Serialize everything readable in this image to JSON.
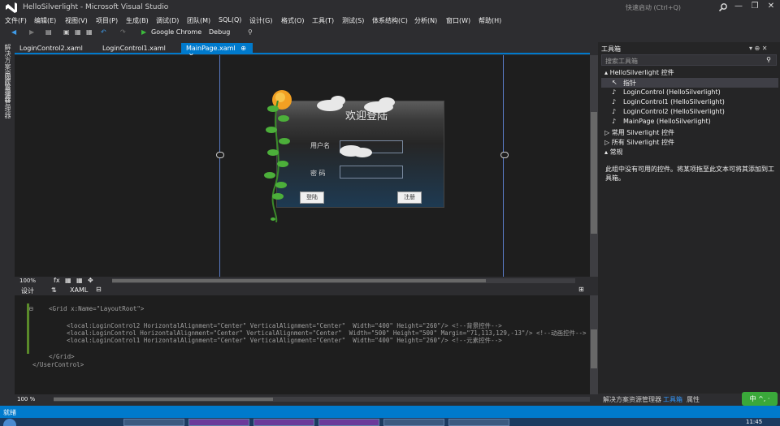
{
  "window": {
    "title": "HelloSilverlight - Microsoft Visual Studio",
    "quick_launch": "快速启动 (Ctrl+Q)",
    "controls": [
      "—",
      "❐",
      "✕"
    ]
  },
  "menu": [
    "文件(F)",
    "编辑(E)",
    "视图(V)",
    "项目(P)",
    "生成(B)",
    "调试(D)",
    "团队(M)",
    "SQL(Q)",
    "设计(G)",
    "格式(O)",
    "工具(T)",
    "测试(S)",
    "体系结构(C)",
    "分析(N)",
    "窗口(W)",
    "帮助(H)"
  ],
  "toolbar": {
    "browser": "Google Chrome",
    "config": "Debug"
  },
  "left_strip": [
    "解决方案资源管理器",
    "团队资源管理器"
  ],
  "doc_tabs": [
    {
      "label": "LoginControl2.xaml",
      "active": false
    },
    {
      "label": "LoginControl1.xaml",
      "active": false
    },
    {
      "label": "MainPage.xaml",
      "active": true,
      "pin": "⊕",
      "close": "✕"
    }
  ],
  "design": {
    "welcome": "欢迎登陆",
    "username_label": "用户名",
    "password_label": "密 码",
    "login_button": "登陆",
    "register_button": "注册"
  },
  "zoom": "100%",
  "split": {
    "design_tab": "设计",
    "swap": "⇅",
    "xaml_tab": "XAML"
  },
  "code": {
    "lines": [
      "<Grid x:Name=\"LayoutRoot\">",
      "<local:LoginControl2 HorizontalAlignment=\"Center\" VerticalAlignment=\"Center\"  Width=\"400\" Height=\"260\"/> <!--背景控件-->",
      "<local:LoginControl HorizontalAlignment=\"Center\" VerticalAlignment=\"Center\"  Width=\"500\" Height=\"500\" Margin=\"71,113,129,-13\"/> <!--动画控件-->",
      "<local:LoginControl1 HorizontalAlignment=\"Center\" VerticalAlignment=\"Center\"  Width=\"400\" Height=\"260\"/> <!--元素控件-->",
      "</Grid>",
      "</UserControl>"
    ],
    "zoom": "100 %"
  },
  "toolbox": {
    "title": "工具箱",
    "search_placeholder": "搜索工具箱",
    "group": "HelloSilverlight 控件",
    "items": [
      "指针",
      "LoginControl (HelloSilverlight)",
      "LoginControl1 (HelloSilverlight)",
      "LoginControl2 (HelloSilverlight)",
      "MainPage (HelloSilverlight)"
    ],
    "other_groups": [
      "常用 Silverlight 控件",
      "所有 Silverlight 控件",
      "常规"
    ],
    "empty_message": "此组中没有可用的控件。将某项拖至此文本可将其添加到工具箱。"
  },
  "bottom_tabs": [
    {
      "label": "解决方案资源管理器",
      "active": false
    },
    {
      "label": "工具箱",
      "active": true
    },
    {
      "label": "属性",
      "active": false
    }
  ],
  "badge": "中 ^, ·",
  "status": "就绪",
  "clock": "11:45"
}
